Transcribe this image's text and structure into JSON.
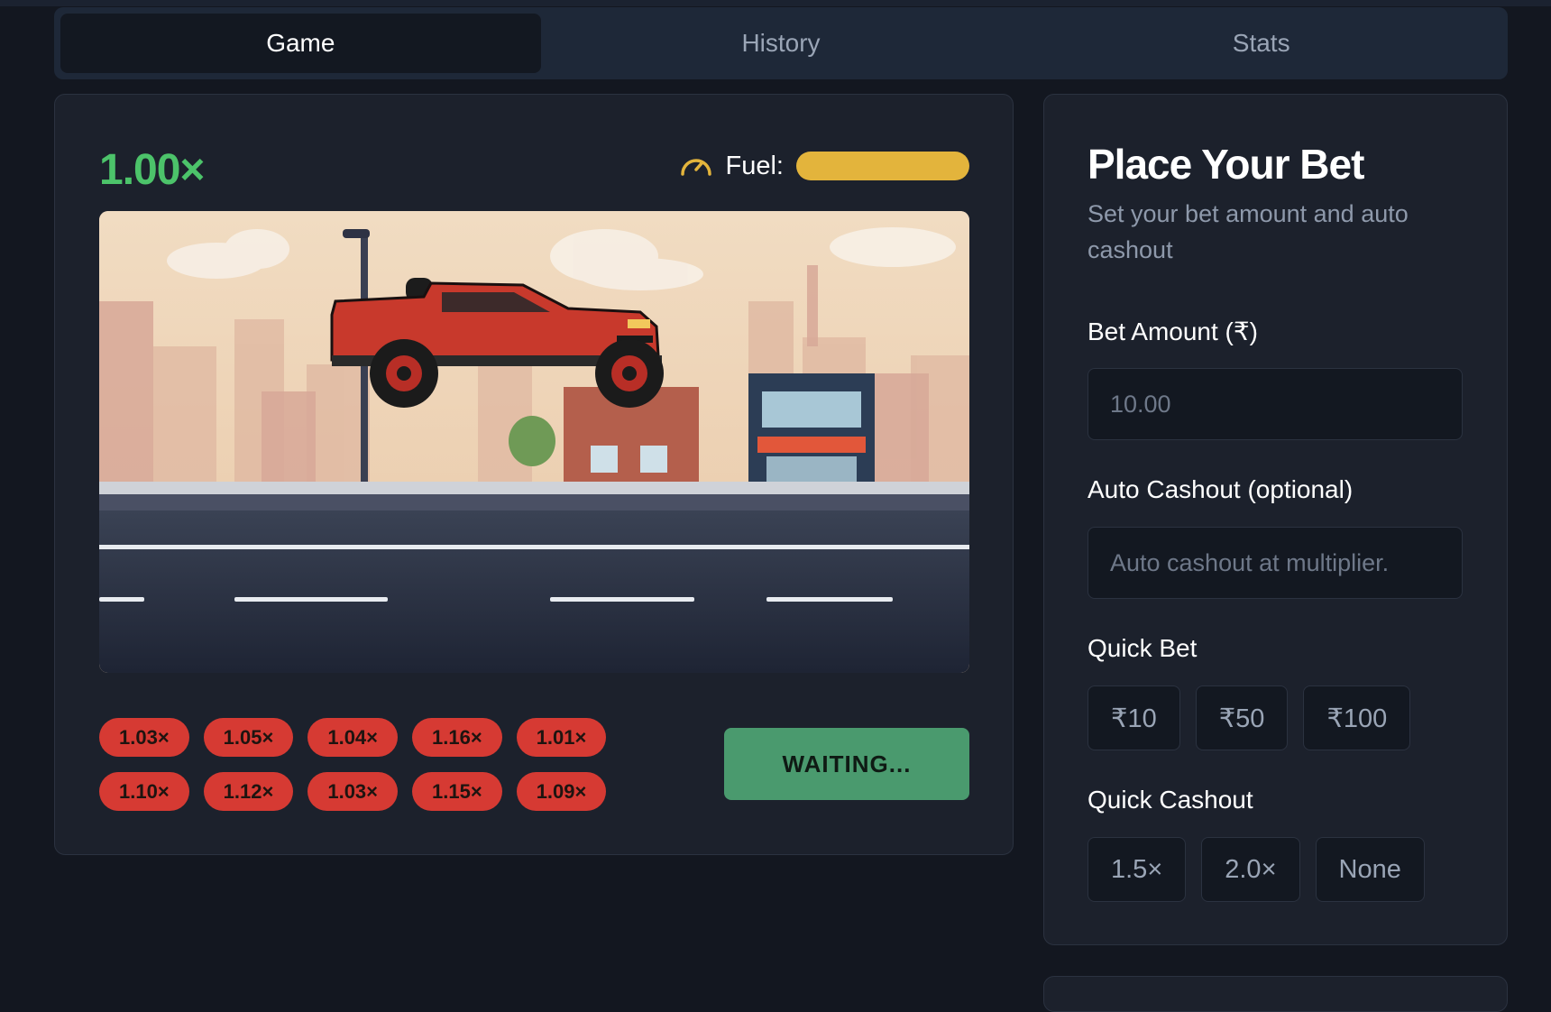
{
  "tabs": [
    {
      "label": "Game",
      "active": true
    },
    {
      "label": "History",
      "active": false
    },
    {
      "label": "Stats",
      "active": false
    }
  ],
  "game": {
    "multiplier": "1.00×",
    "fuel_label": "Fuel:",
    "fuel_level": 1.0,
    "history_row1": [
      "1.03×",
      "1.05×",
      "1.04×",
      "1.16×",
      "1.01×"
    ],
    "history_row2": [
      "1.10×",
      "1.12×",
      "1.03×",
      "1.15×",
      "1.09×"
    ],
    "status_button": "WAITING..."
  },
  "bet": {
    "title": "Place Your Bet",
    "subtitle": "Set your bet amount and auto cashout",
    "amount_label": "Bet Amount (₹)",
    "amount_value": "10.00",
    "auto_label": "Auto Cashout (optional)",
    "auto_placeholder": "Auto cashout at multiplier.",
    "quick_bet_label": "Quick Bet",
    "quick_bets": [
      "₹10",
      "₹50",
      "₹100"
    ],
    "quick_cashout_label": "Quick Cashout",
    "quick_cashouts": [
      "1.5×",
      "2.0×",
      "None"
    ]
  },
  "colors": {
    "accent_green": "#4cc36a",
    "fuel": "#e3b43c",
    "chip_red": "#d63a33",
    "waiting_green": "#4a9a6e"
  },
  "icons": {
    "fuel": "speedometer-icon",
    "vehicle": "red-pickup-truck"
  }
}
